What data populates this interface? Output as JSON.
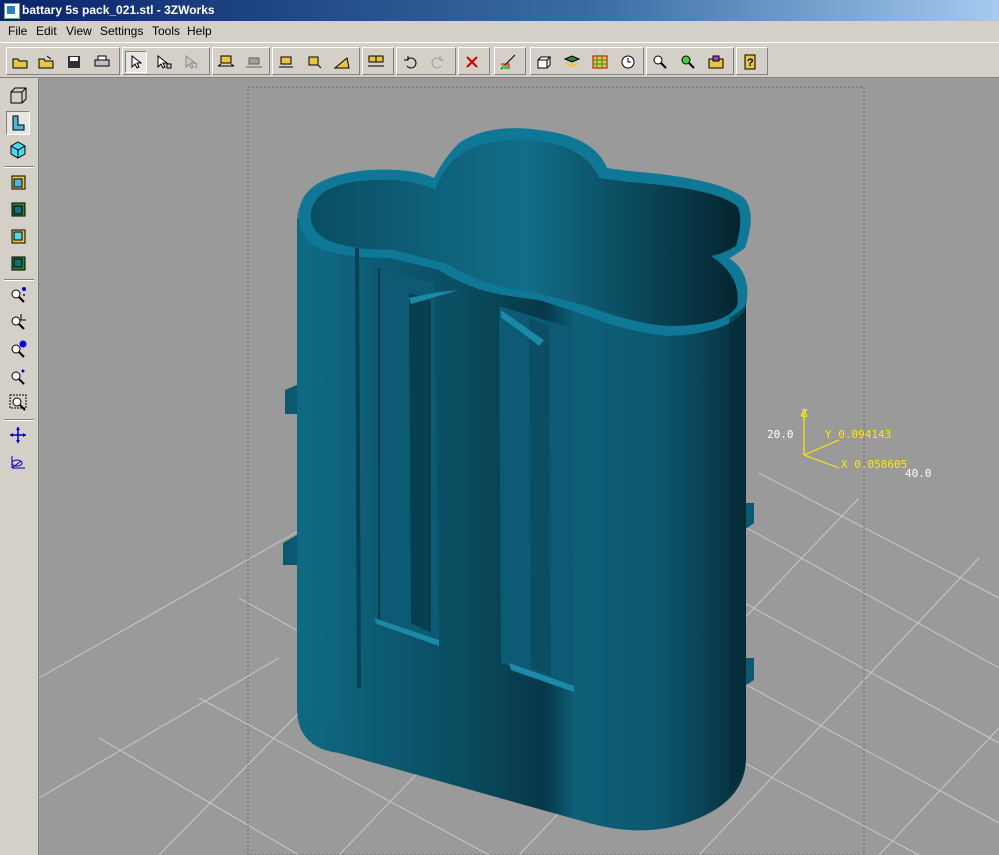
{
  "window": {
    "title": "battary 5s pack_021.stl - 3ZWorks"
  },
  "menu": [
    "File",
    "Edit",
    "View",
    "Settings",
    "Tools",
    "Help"
  ],
  "toolbar_icons": [
    "open-folder",
    "open-folder-2",
    "save",
    "print",
    "select-arrow",
    "select-vertex",
    "select-z",
    "move-horizontal",
    "move-flat",
    "align-top",
    "align-rotate",
    "angle",
    "group-objects",
    "undo",
    "redo",
    "delete-red",
    "grid-measure",
    "box-view",
    "layers",
    "grid-table",
    "clock",
    "zoom-window",
    "zoom-all",
    "properties",
    "help"
  ],
  "sidebar_icons": [
    "view-wire-box",
    "view-shaded-l",
    "view-cube",
    "view-front",
    "view-back",
    "view-side",
    "view-bottom",
    "zoom-dots",
    "zoom-crop",
    "zoom-in-blue",
    "zoom-point",
    "zoom-frame",
    "pan-move",
    "rotate-axis"
  ],
  "axis": {
    "z_label": "Z",
    "y_readout": "Y 0.094143",
    "x_readout": "X 0.058605",
    "grid_label_20": "20.0",
    "grid_label_40": "40.0"
  },
  "colors": {
    "model": "#0d5a72",
    "viewport_bg": "#9a9a9a",
    "axis": "#ffe800"
  }
}
